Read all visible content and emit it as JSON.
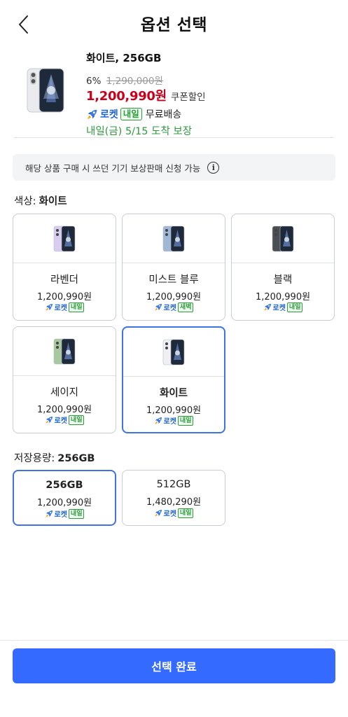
{
  "header": {
    "title": "옵션 선택",
    "back_icon": "chevron-left-icon"
  },
  "product": {
    "name": "화이트, 256GB",
    "discount_rate": "6%",
    "original_price": "1,290,000원",
    "price": "1,200,990원",
    "coupon_label": "쿠폰할인",
    "rocket_label": "로켓",
    "badge": "내일",
    "shipping": "무료배송",
    "arrival": "내일(금) 5/15 도착 보장"
  },
  "tradein": {
    "text": "해당 상품 구매 시 쓰던 기기 보상판매 신청 가능",
    "icon": "info-icon"
  },
  "color_section": {
    "label": "색상:",
    "selected": "화이트",
    "options": [
      {
        "name": "라벤더",
        "price": "1,200,990원",
        "rocket": "로켓",
        "badge": "내일",
        "color": "#d8cdf0",
        "selected": false
      },
      {
        "name": "미스트 블루",
        "price": "1,200,990원",
        "rocket": "로켓",
        "badge": "새벽",
        "color": "#9fb8d8",
        "selected": false
      },
      {
        "name": "블랙",
        "price": "1,200,990원",
        "rocket": "로켓",
        "badge": "내일",
        "color": "#4a4d52",
        "selected": false
      },
      {
        "name": "세이지",
        "price": "1,200,990원",
        "rocket": "로켓",
        "badge": "내일",
        "color": "#a8c8a0",
        "selected": false
      },
      {
        "name": "화이트",
        "price": "1,200,990원",
        "rocket": "로켓",
        "badge": "내일",
        "color": "#eef0f3",
        "selected": true
      }
    ]
  },
  "storage_section": {
    "label": "저장용량:",
    "selected": "256GB",
    "options": [
      {
        "name": "256GB",
        "price": "1,200,990원",
        "rocket": "로켓",
        "badge": "내일",
        "selected": true
      },
      {
        "name": "512GB",
        "price": "1,480,290원",
        "rocket": "로켓",
        "badge": "내일",
        "selected": false
      }
    ]
  },
  "footer": {
    "confirm_label": "선택 완료"
  },
  "colors": {
    "accent": "#346aff",
    "price_red": "#c9001c",
    "rocket_blue": "#1c63d7",
    "green": "#2d9b3c",
    "selected_border": "#3f73e0"
  }
}
